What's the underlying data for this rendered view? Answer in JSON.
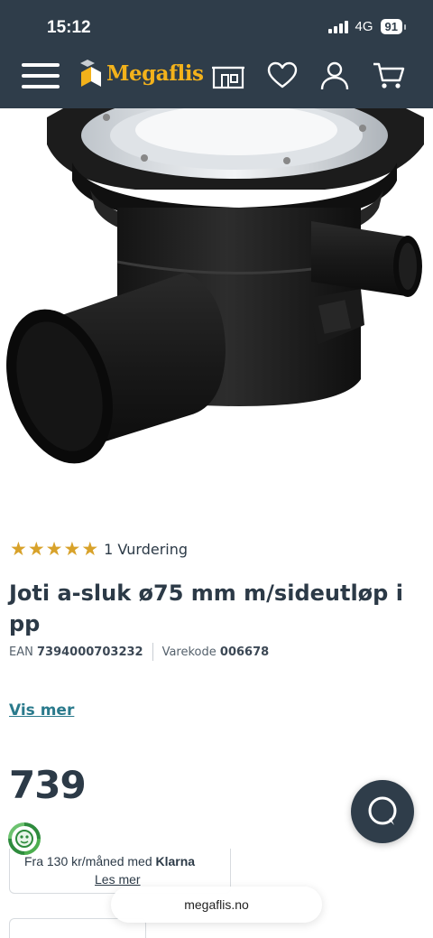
{
  "status_bar": {
    "time": "15:12",
    "network": "4G",
    "battery": "91"
  },
  "header": {
    "logo_text": "Megaflis",
    "icons": [
      "menu-icon",
      "store-icon",
      "heart-icon",
      "account-icon",
      "cart-icon"
    ]
  },
  "product": {
    "rating_text": "1 Vurdering",
    "stars": 5,
    "title": "Joti a-sluk ø75 mm m/sideutløp i pp",
    "ean_label": "EAN",
    "ean_value": "7394000703232",
    "sku_label": "Varekode",
    "sku_value": "006678",
    "more_link": "Vis mer",
    "price": "739"
  },
  "klarna": {
    "line_prefix": "Fra 130 kr/måned med",
    "brand": "Klarna",
    "read_more": "Les mer"
  },
  "browser": {
    "url": "megaflis.no"
  },
  "colors": {
    "header_bg": "#2f3d4a",
    "logo": "#f3b21b",
    "star": "#d8a22a",
    "link": "#2a7a8c",
    "text": "#2c3a47"
  }
}
